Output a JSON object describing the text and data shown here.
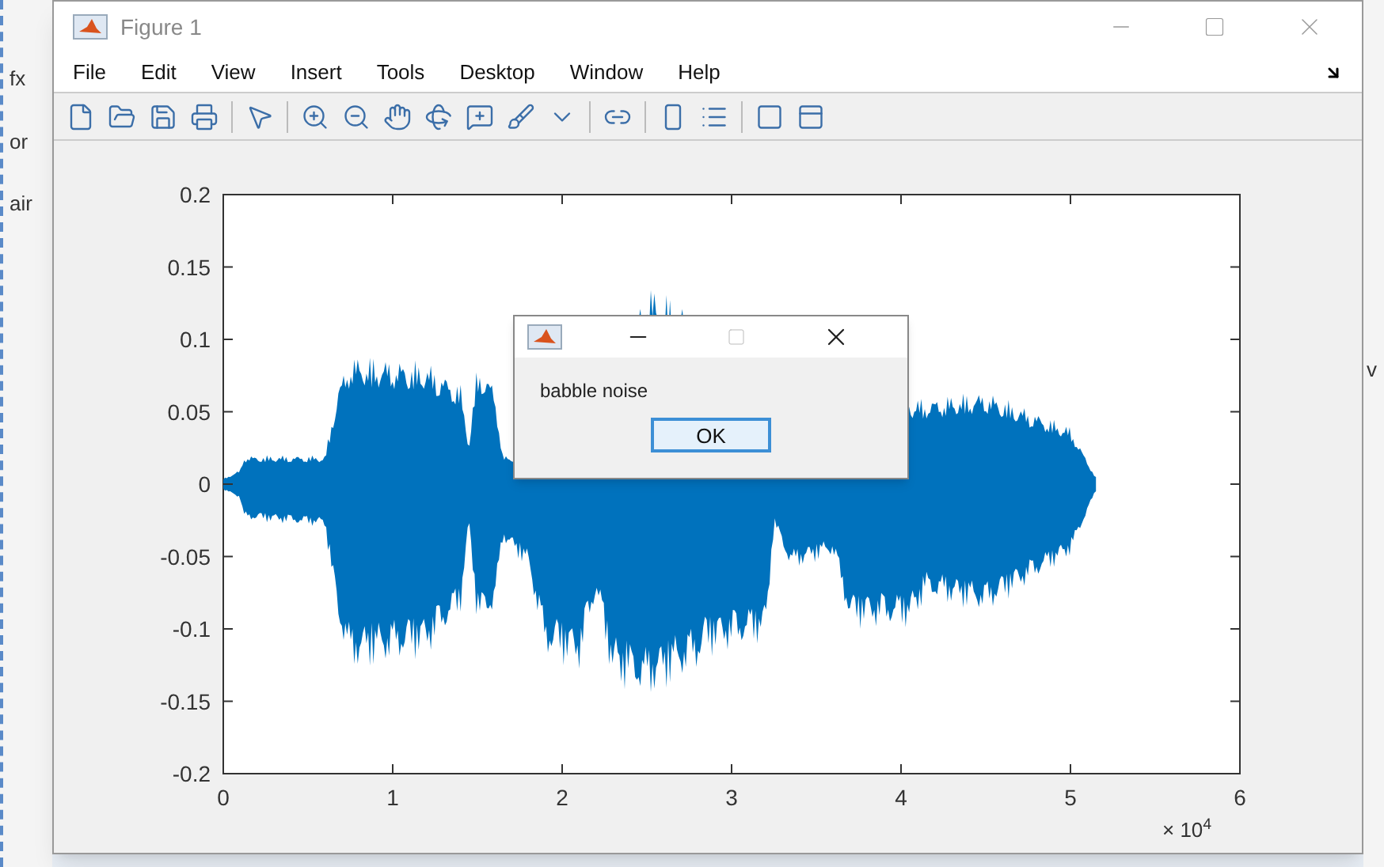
{
  "background": {
    "left_texts": [
      "fx",
      "or",
      "air"
    ],
    "right_texts": [
      "v"
    ]
  },
  "window": {
    "title": "Figure 1"
  },
  "menu": [
    "File",
    "Edit",
    "View",
    "Insert",
    "Tools",
    "Desktop",
    "Window",
    "Help"
  ],
  "axes": {
    "yticks": [
      "0.2",
      "0.15",
      "0.1",
      "0.05",
      "0",
      "-0.05",
      "-0.1",
      "-0.15",
      "-0.2"
    ],
    "xticks": [
      "0",
      "1",
      "2",
      "3",
      "4",
      "5",
      "6"
    ],
    "x_multiplier": "× 10$^{4}$"
  },
  "dialog": {
    "message": "babble noise",
    "button": "OK"
  }
}
